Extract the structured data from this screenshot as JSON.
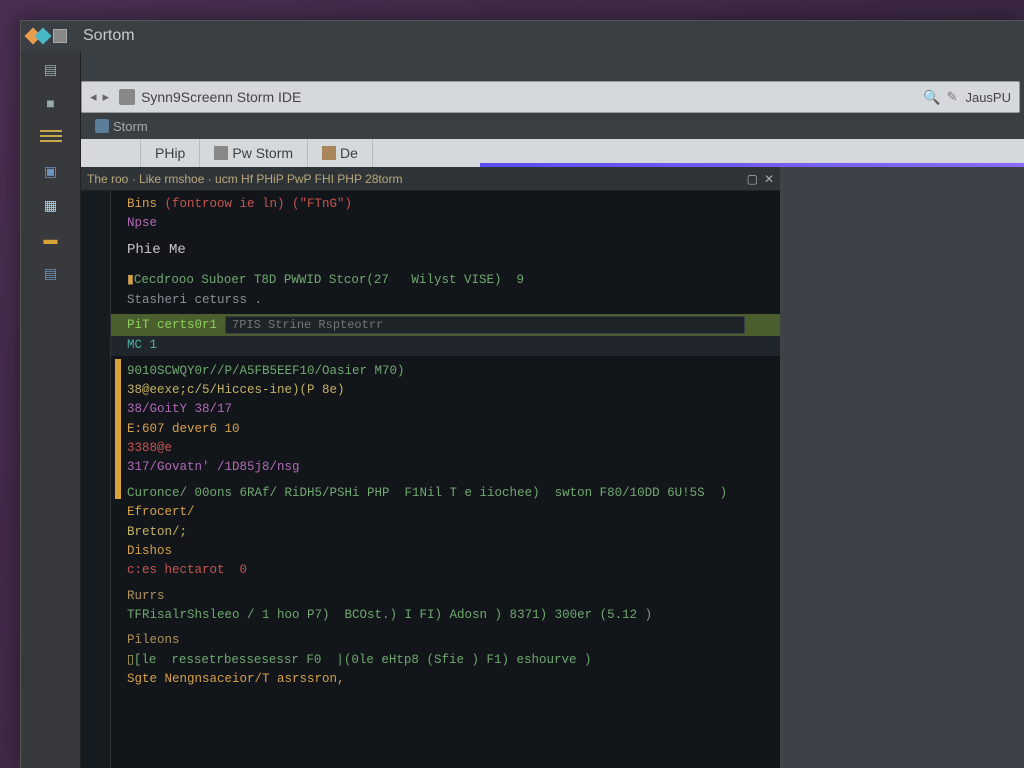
{
  "window": {
    "title": "Sortom"
  },
  "address_bar": {
    "text": "Synn9Screenn Storm IDE",
    "right_label": "JausPU"
  },
  "file_tab": {
    "label": "Storm"
  },
  "menu": {
    "php": "PHip",
    "phpstorm": "Pw Storm",
    "de": "De"
  },
  "editor_tab": {
    "text": "The roo · Like rmshoe · ucm Hf PHiP PwP FHI PHP 28torm",
    "min": "▢",
    "close": "✕"
  },
  "code": {
    "l1a": "Bins",
    "l1b": "(fontroow ie ln) (\"FTnG\")",
    "l2a": "Npse",
    "l3": "Phie Me",
    "l4a": "Cecdrooo Suboer T8D PWWID Stcor(27   Wilyst VISE)  9",
    "l4b": "Stasheri ceturss .",
    "comp_left": "PiT certs0r1",
    "comp_placeholder": "7PIS Strine Rspteotrr",
    "comp_sub": "MC 1",
    "l6": "9010SCWQY0r//P/A5FB5EEF10/Oasier M70)",
    "l7": "38@eexe;c/5/Hicces-ine)(P 8e)",
    "l8": "38/GoitY 38/17",
    "l9": "E:607 dever6 10",
    "l10": "3388@e",
    "l11": "317/Govatn' /1D85j8/nsg",
    "l12": "Curonce/ 00ons 6RAf/ RiDH5/PSHi PHP  F1Nil T e iiochee)  swton F80/10DD 6U!5S  )",
    "l13": "Efrocert/",
    "l14": "Breton/;",
    "l15": "Dishos",
    "l16": "c:es hectarot  0",
    "sec1": "Rurrs",
    "l17": "TFRisalrShsleeo / 1 hoo P7)  BCOst.) I FI) Adosn ) 8371) 300er (5.12 )",
    "sec2": "Pîleons",
    "l18": "[le  ressetrbessesessr F0  |(0le eHtp8 (Sfie ) F1) eshourve )",
    "l19": "Sgte Nengnsaceior/T asrssron,"
  }
}
